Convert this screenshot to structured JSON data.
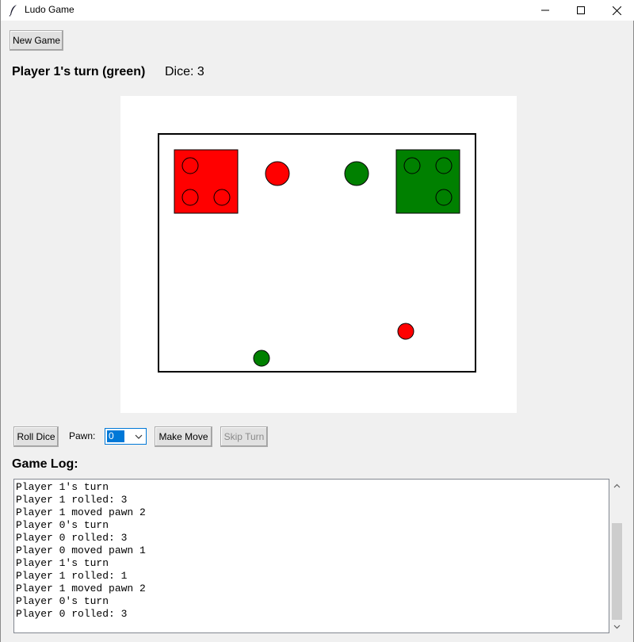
{
  "window": {
    "title": "Ludo Game",
    "icon": "feather-icon"
  },
  "toolbar": {
    "new_game_label": "New Game"
  },
  "status": {
    "turn_text": "Player 1's turn (green)",
    "dice_text": "Dice: 3"
  },
  "board": {
    "colors": {
      "red": "#ff0000",
      "green": "#008000",
      "border": "#000000",
      "background": "#ffffff"
    }
  },
  "controls": {
    "roll_label": "Roll Dice",
    "pawn_label": "Pawn:",
    "pawn_selected": "0",
    "move_label": "Make Move",
    "skip_label": "Skip Turn",
    "skip_enabled": false
  },
  "log": {
    "title": "Game Log:",
    "lines": [
      "Player 1's turn",
      "Player 1 rolled: 3",
      "Player 1 moved pawn 2",
      "Player 0's turn",
      "Player 0 rolled: 3",
      "Player 0 moved pawn 1",
      "Player 1's turn",
      "Player 1 rolled: 1",
      "Player 1 moved pawn 2",
      "Player 0's turn",
      "Player 0 rolled: 3"
    ]
  }
}
